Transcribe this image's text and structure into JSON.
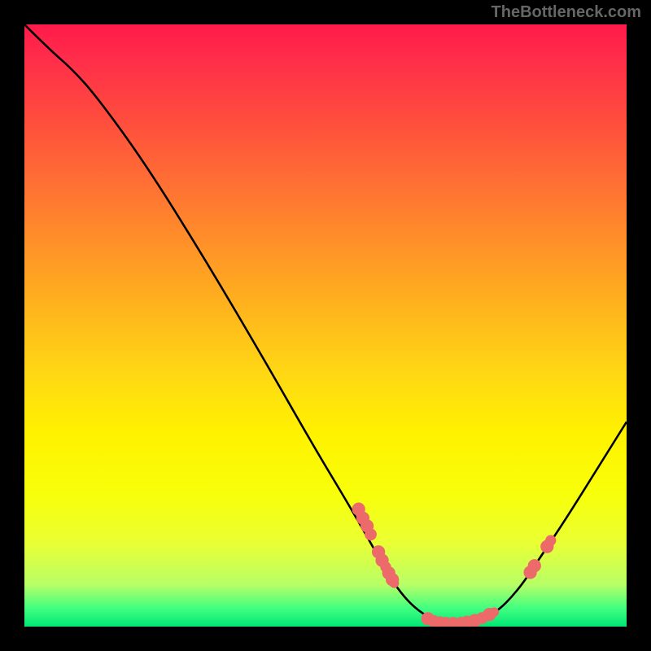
{
  "watermark": "TheBottleneck.com",
  "chart_data": {
    "type": "line",
    "title": "",
    "xlabel": "",
    "ylabel": "",
    "x_range": [
      0,
      100
    ],
    "y_range": [
      0,
      100
    ],
    "curve": [
      {
        "x": 0,
        "y": 100
      },
      {
        "x": 4,
        "y": 96
      },
      {
        "x": 8,
        "y": 92.5
      },
      {
        "x": 12,
        "y": 88
      },
      {
        "x": 20,
        "y": 77
      },
      {
        "x": 30,
        "y": 61
      },
      {
        "x": 40,
        "y": 44
      },
      {
        "x": 48,
        "y": 30
      },
      {
        "x": 54,
        "y": 20
      },
      {
        "x": 58,
        "y": 13
      },
      {
        "x": 62,
        "y": 6
      },
      {
        "x": 66,
        "y": 2
      },
      {
        "x": 70,
        "y": 0.5
      },
      {
        "x": 74,
        "y": 0.5
      },
      {
        "x": 78,
        "y": 2
      },
      {
        "x": 82,
        "y": 6
      },
      {
        "x": 86,
        "y": 12
      },
      {
        "x": 90,
        "y": 18
      },
      {
        "x": 95,
        "y": 26
      },
      {
        "x": 100,
        "y": 34
      }
    ],
    "markers": [
      {
        "x": 55.5,
        "y": 19.5,
        "r": 1.1
      },
      {
        "x": 56.2,
        "y": 18.0,
        "r": 1.1
      },
      {
        "x": 56.9,
        "y": 16.7,
        "r": 1.1
      },
      {
        "x": 57.5,
        "y": 15.3,
        "r": 1.0
      },
      {
        "x": 58.8,
        "y": 12.4,
        "r": 1.1
      },
      {
        "x": 59.4,
        "y": 11.0,
        "r": 1.1
      },
      {
        "x": 60.0,
        "y": 9.9,
        "r": 0.9
      },
      {
        "x": 60.5,
        "y": 8.9,
        "r": 1.1
      },
      {
        "x": 61.1,
        "y": 7.8,
        "r": 1.1
      },
      {
        "x": 61.4,
        "y": 7.2,
        "r": 0.8
      },
      {
        "x": 67.0,
        "y": 1.3,
        "r": 1.1
      },
      {
        "x": 68.0,
        "y": 0.9,
        "r": 1.0
      },
      {
        "x": 69.0,
        "y": 0.6,
        "r": 1.1
      },
      {
        "x": 70.0,
        "y": 0.5,
        "r": 1.1
      },
      {
        "x": 71.2,
        "y": 0.5,
        "r": 1.1
      },
      {
        "x": 72.5,
        "y": 0.6,
        "r": 1.0
      },
      {
        "x": 73.5,
        "y": 0.7,
        "r": 1.1
      },
      {
        "x": 74.8,
        "y": 1.0,
        "r": 1.1
      },
      {
        "x": 76.0,
        "y": 1.4,
        "r": 1.0
      },
      {
        "x": 77.2,
        "y": 2.0,
        "r": 1.1
      },
      {
        "x": 78.0,
        "y": 2.4,
        "r": 0.8
      },
      {
        "x": 84.0,
        "y": 9.0,
        "r": 1.1
      },
      {
        "x": 84.7,
        "y": 10.1,
        "r": 1.1
      },
      {
        "x": 86.8,
        "y": 13.3,
        "r": 1.1
      },
      {
        "x": 87.4,
        "y": 14.3,
        "r": 0.9
      }
    ],
    "marker_color": "#ec6a6a",
    "curve_color": "#000000",
    "gradient_stops": [
      {
        "offset": 0.0,
        "color": "#ff1a4a"
      },
      {
        "offset": 0.5,
        "color": "#ffad1f"
      },
      {
        "offset": 0.78,
        "color": "#fff200"
      },
      {
        "offset": 1.0,
        "color": "#00e676"
      }
    ]
  }
}
